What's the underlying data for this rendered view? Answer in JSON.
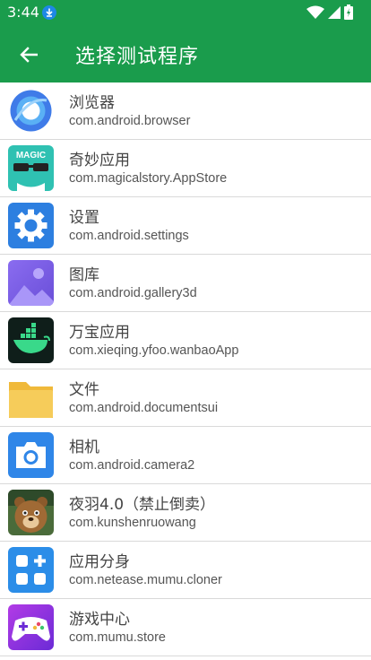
{
  "status": {
    "time": "3:44"
  },
  "appbar": {
    "title": "选择测试程序"
  },
  "apps": [
    {
      "name": "浏览器",
      "package": "com.android.browser",
      "icon": "browser-icon"
    },
    {
      "name": "奇妙应用",
      "package": "com.magicalstory.AppStore",
      "icon": "magic-app-icon",
      "icon_text": "MAGIC"
    },
    {
      "name": "设置",
      "package": "com.android.settings",
      "icon": "gear-icon"
    },
    {
      "name": "图库",
      "package": "com.android.gallery3d",
      "icon": "gallery-icon"
    },
    {
      "name": "万宝应用",
      "package": "com.xieqing.yfoo.wanbaoApp",
      "icon": "whale-icon"
    },
    {
      "name": "文件",
      "package": "com.android.documentsui",
      "icon": "folder-icon"
    },
    {
      "name": "相机",
      "package": "com.android.camera2",
      "icon": "camera-icon"
    },
    {
      "name": "夜羽4.0（禁止倒卖）",
      "package": "com.kunshenruowang",
      "icon": "bear-icon"
    },
    {
      "name": "应用分身",
      "package": "com.netease.mumu.cloner",
      "icon": "app-cloner-icon"
    },
    {
      "name": "游戏中心",
      "package": "com.mumu.store",
      "icon": "gamepad-icon"
    }
  ]
}
